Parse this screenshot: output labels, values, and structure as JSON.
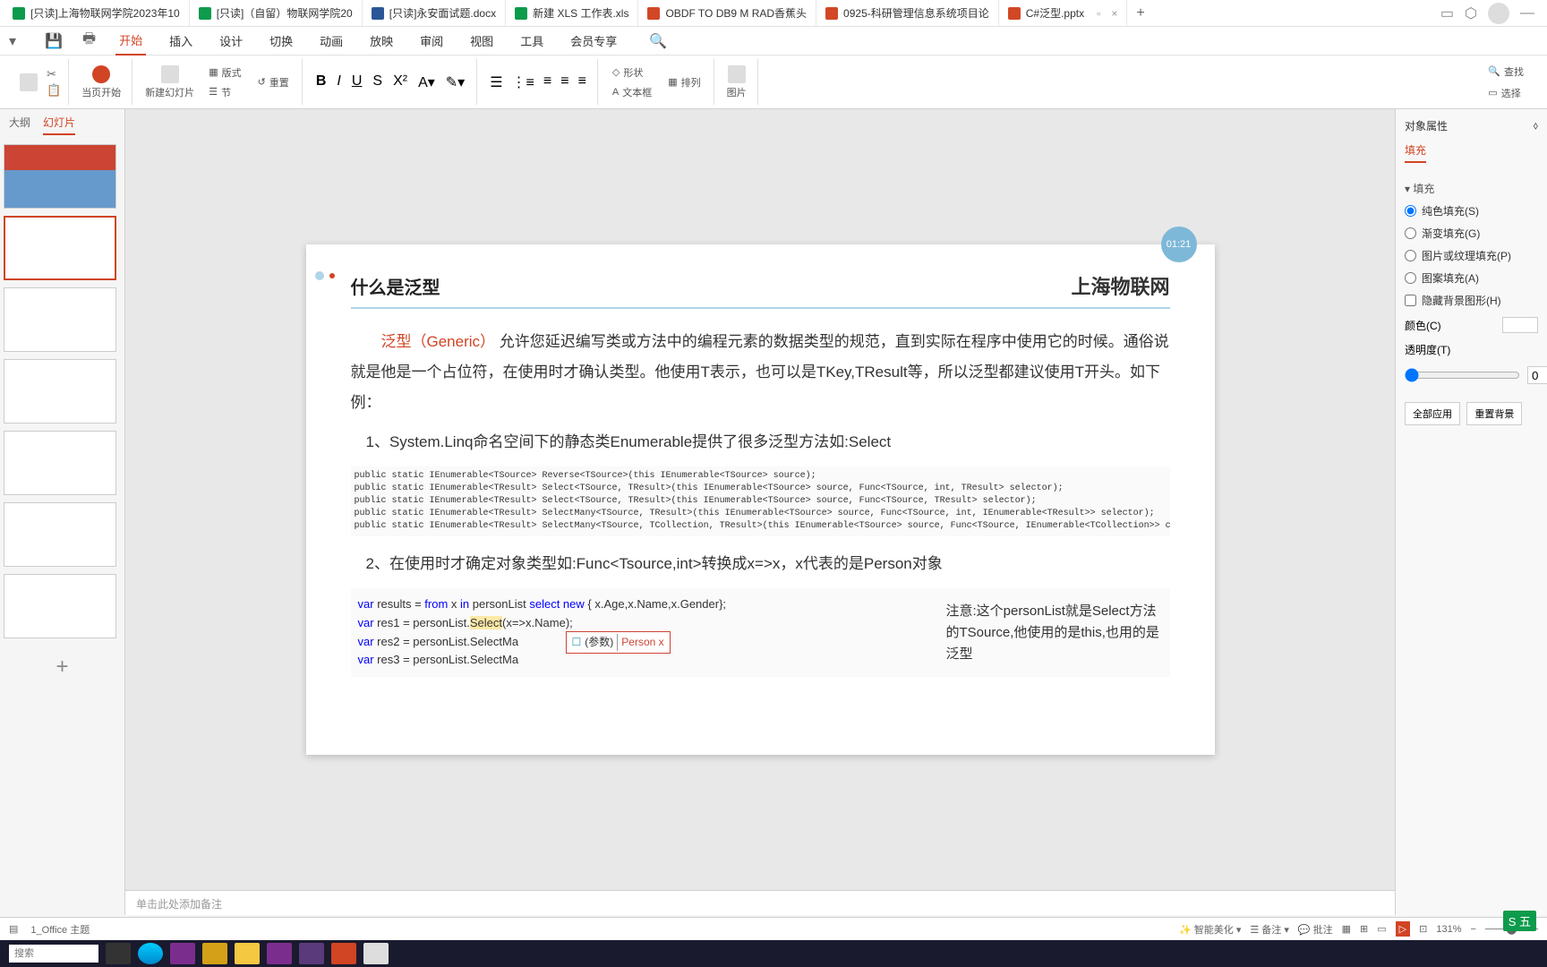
{
  "tabs": [
    {
      "icon": "green",
      "label": "[只读]上海物联网学院2023年10"
    },
    {
      "icon": "green",
      "label": "[只读]（自留）物联网学院20"
    },
    {
      "icon": "blue",
      "label": "[只读]永安面试题.docx"
    },
    {
      "icon": "green",
      "label": "新建 XLS 工作表.xls"
    },
    {
      "icon": "orange",
      "label": "OBDF TO DB9 M RAD香蕉头"
    },
    {
      "icon": "orange",
      "label": "0925-科研管理信息系统项目论"
    },
    {
      "icon": "orange",
      "label": "C#泛型.pptx",
      "active": true
    }
  ],
  "ribbon_tabs": [
    "开始",
    "插入",
    "设计",
    "切换",
    "动画",
    "放映",
    "审阅",
    "视图",
    "工具",
    "会员专享"
  ],
  "ribbon_active": 0,
  "toolbar": {
    "current_page": "当页开始",
    "new_slide": "新建幻灯片",
    "layout": "版式",
    "section": "节",
    "reset": "重置",
    "shape": "形状",
    "textbox": "文本框",
    "arrange": "排列",
    "picture": "图片",
    "find": "查找",
    "select": "选择"
  },
  "left_tabs": {
    "outline": "大纲",
    "slides": "幻灯片"
  },
  "timer": "01:21",
  "slide": {
    "title": "什么是泛型",
    "brand": "上海物联网",
    "para1_a": "泛型（Generic）",
    "para1_b": " 允许您延迟编写类或方法中的编程元素的数据类型的规范，直到实际在程序中使用它的时候。通俗说就是他是一个占位符，在使用时才确认类型。他使用T表示，也可以是TKey,TResult等，所以泛型都建议使用T开头。如下例：",
    "item1": "1、System.Linq命名空间下的静态类Enumerable提供了很多泛型方法如:Select",
    "code1": "public static IEnumerable<TSource> Reverse<TSource>(this IEnumerable<TSource> source);\npublic static IEnumerable<TResult> Select<TSource, TResult>(this IEnumerable<TSource> source, Func<TSource, int, TResult> selector);\npublic static IEnumerable<TResult> Select<TSource, TResult>(this IEnumerable<TSource> source, Func<TSource, TResult> selector);\npublic static IEnumerable<TResult> SelectMany<TSource, TResult>(this IEnumerable<TSource> source, Func<TSource, int, IEnumerable<TResult>> selector);\npublic static IEnumerable<TResult> SelectMany<TSource, TCollection, TResult>(this IEnumerable<TSource> source, Func<TSource, IEnumerable<TCollection>> collectionSelector, Func<TSource,",
    "item2": "2、在使用时才确定对象类型如:Func<Tsource,int>转换成x=>x，x代表的是Person对象",
    "code2_l1": "var results = from x in personList select new { x.Age,x.Name,x.Gender};",
    "code2_l2a": "var res1 = personList.",
    "code2_l2b": "Select",
    "code2_l2c": "(x=>x.Name);",
    "code2_l3": "var res2 = personList.SelectMa",
    "code2_l4": "var res3 = personList.SelectMa",
    "tooltip_param": "(参数)",
    "tooltip_type": "Person x",
    "note": "注意:这个personList就是Select方法的TSource,他使用的是this,也用的是泛型"
  },
  "notes_placeholder": "单击此处添加备注",
  "right_panel": {
    "title": "对象属性",
    "section": "填充",
    "group": "填充",
    "opt_solid": "纯色填充(S)",
    "opt_gradient": "渐变填充(G)",
    "opt_picture": "图片或纹理填充(P)",
    "opt_pattern": "图案填充(A)",
    "chk_hide": "隐藏背景图形(H)",
    "color": "颜色(C)",
    "opacity": "透明度(T)",
    "opacity_val": "0",
    "opacity_unit": "%",
    "apply_all": "全部应用",
    "reset_bg": "重置背景"
  },
  "status": {
    "theme": "1_Office 主题",
    "beautify": "智能美化",
    "notes": "备注",
    "comments": "批注",
    "zoom": "131%"
  },
  "ime": "五",
  "search_placeholder": "搜索"
}
